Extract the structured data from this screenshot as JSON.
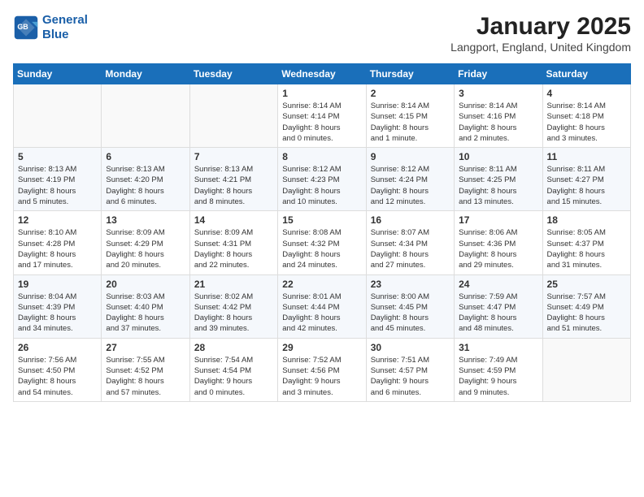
{
  "header": {
    "logo_line1": "General",
    "logo_line2": "Blue",
    "month": "January 2025",
    "location": "Langport, England, United Kingdom"
  },
  "weekdays": [
    "Sunday",
    "Monday",
    "Tuesday",
    "Wednesday",
    "Thursday",
    "Friday",
    "Saturday"
  ],
  "weeks": [
    [
      {
        "day": "",
        "info": ""
      },
      {
        "day": "",
        "info": ""
      },
      {
        "day": "",
        "info": ""
      },
      {
        "day": "1",
        "info": "Sunrise: 8:14 AM\nSunset: 4:14 PM\nDaylight: 8 hours\nand 0 minutes."
      },
      {
        "day": "2",
        "info": "Sunrise: 8:14 AM\nSunset: 4:15 PM\nDaylight: 8 hours\nand 1 minute."
      },
      {
        "day": "3",
        "info": "Sunrise: 8:14 AM\nSunset: 4:16 PM\nDaylight: 8 hours\nand 2 minutes."
      },
      {
        "day": "4",
        "info": "Sunrise: 8:14 AM\nSunset: 4:18 PM\nDaylight: 8 hours\nand 3 minutes."
      }
    ],
    [
      {
        "day": "5",
        "info": "Sunrise: 8:13 AM\nSunset: 4:19 PM\nDaylight: 8 hours\nand 5 minutes."
      },
      {
        "day": "6",
        "info": "Sunrise: 8:13 AM\nSunset: 4:20 PM\nDaylight: 8 hours\nand 6 minutes."
      },
      {
        "day": "7",
        "info": "Sunrise: 8:13 AM\nSunset: 4:21 PM\nDaylight: 8 hours\nand 8 minutes."
      },
      {
        "day": "8",
        "info": "Sunrise: 8:12 AM\nSunset: 4:23 PM\nDaylight: 8 hours\nand 10 minutes."
      },
      {
        "day": "9",
        "info": "Sunrise: 8:12 AM\nSunset: 4:24 PM\nDaylight: 8 hours\nand 12 minutes."
      },
      {
        "day": "10",
        "info": "Sunrise: 8:11 AM\nSunset: 4:25 PM\nDaylight: 8 hours\nand 13 minutes."
      },
      {
        "day": "11",
        "info": "Sunrise: 8:11 AM\nSunset: 4:27 PM\nDaylight: 8 hours\nand 15 minutes."
      }
    ],
    [
      {
        "day": "12",
        "info": "Sunrise: 8:10 AM\nSunset: 4:28 PM\nDaylight: 8 hours\nand 17 minutes."
      },
      {
        "day": "13",
        "info": "Sunrise: 8:09 AM\nSunset: 4:29 PM\nDaylight: 8 hours\nand 20 minutes."
      },
      {
        "day": "14",
        "info": "Sunrise: 8:09 AM\nSunset: 4:31 PM\nDaylight: 8 hours\nand 22 minutes."
      },
      {
        "day": "15",
        "info": "Sunrise: 8:08 AM\nSunset: 4:32 PM\nDaylight: 8 hours\nand 24 minutes."
      },
      {
        "day": "16",
        "info": "Sunrise: 8:07 AM\nSunset: 4:34 PM\nDaylight: 8 hours\nand 27 minutes."
      },
      {
        "day": "17",
        "info": "Sunrise: 8:06 AM\nSunset: 4:36 PM\nDaylight: 8 hours\nand 29 minutes."
      },
      {
        "day": "18",
        "info": "Sunrise: 8:05 AM\nSunset: 4:37 PM\nDaylight: 8 hours\nand 31 minutes."
      }
    ],
    [
      {
        "day": "19",
        "info": "Sunrise: 8:04 AM\nSunset: 4:39 PM\nDaylight: 8 hours\nand 34 minutes."
      },
      {
        "day": "20",
        "info": "Sunrise: 8:03 AM\nSunset: 4:40 PM\nDaylight: 8 hours\nand 37 minutes."
      },
      {
        "day": "21",
        "info": "Sunrise: 8:02 AM\nSunset: 4:42 PM\nDaylight: 8 hours\nand 39 minutes."
      },
      {
        "day": "22",
        "info": "Sunrise: 8:01 AM\nSunset: 4:44 PM\nDaylight: 8 hours\nand 42 minutes."
      },
      {
        "day": "23",
        "info": "Sunrise: 8:00 AM\nSunset: 4:45 PM\nDaylight: 8 hours\nand 45 minutes."
      },
      {
        "day": "24",
        "info": "Sunrise: 7:59 AM\nSunset: 4:47 PM\nDaylight: 8 hours\nand 48 minutes."
      },
      {
        "day": "25",
        "info": "Sunrise: 7:57 AM\nSunset: 4:49 PM\nDaylight: 8 hours\nand 51 minutes."
      }
    ],
    [
      {
        "day": "26",
        "info": "Sunrise: 7:56 AM\nSunset: 4:50 PM\nDaylight: 8 hours\nand 54 minutes."
      },
      {
        "day": "27",
        "info": "Sunrise: 7:55 AM\nSunset: 4:52 PM\nDaylight: 8 hours\nand 57 minutes."
      },
      {
        "day": "28",
        "info": "Sunrise: 7:54 AM\nSunset: 4:54 PM\nDaylight: 9 hours\nand 0 minutes."
      },
      {
        "day": "29",
        "info": "Sunrise: 7:52 AM\nSunset: 4:56 PM\nDaylight: 9 hours\nand 3 minutes."
      },
      {
        "day": "30",
        "info": "Sunrise: 7:51 AM\nSunset: 4:57 PM\nDaylight: 9 hours\nand 6 minutes."
      },
      {
        "day": "31",
        "info": "Sunrise: 7:49 AM\nSunset: 4:59 PM\nDaylight: 9 hours\nand 9 minutes."
      },
      {
        "day": "",
        "info": ""
      }
    ]
  ]
}
